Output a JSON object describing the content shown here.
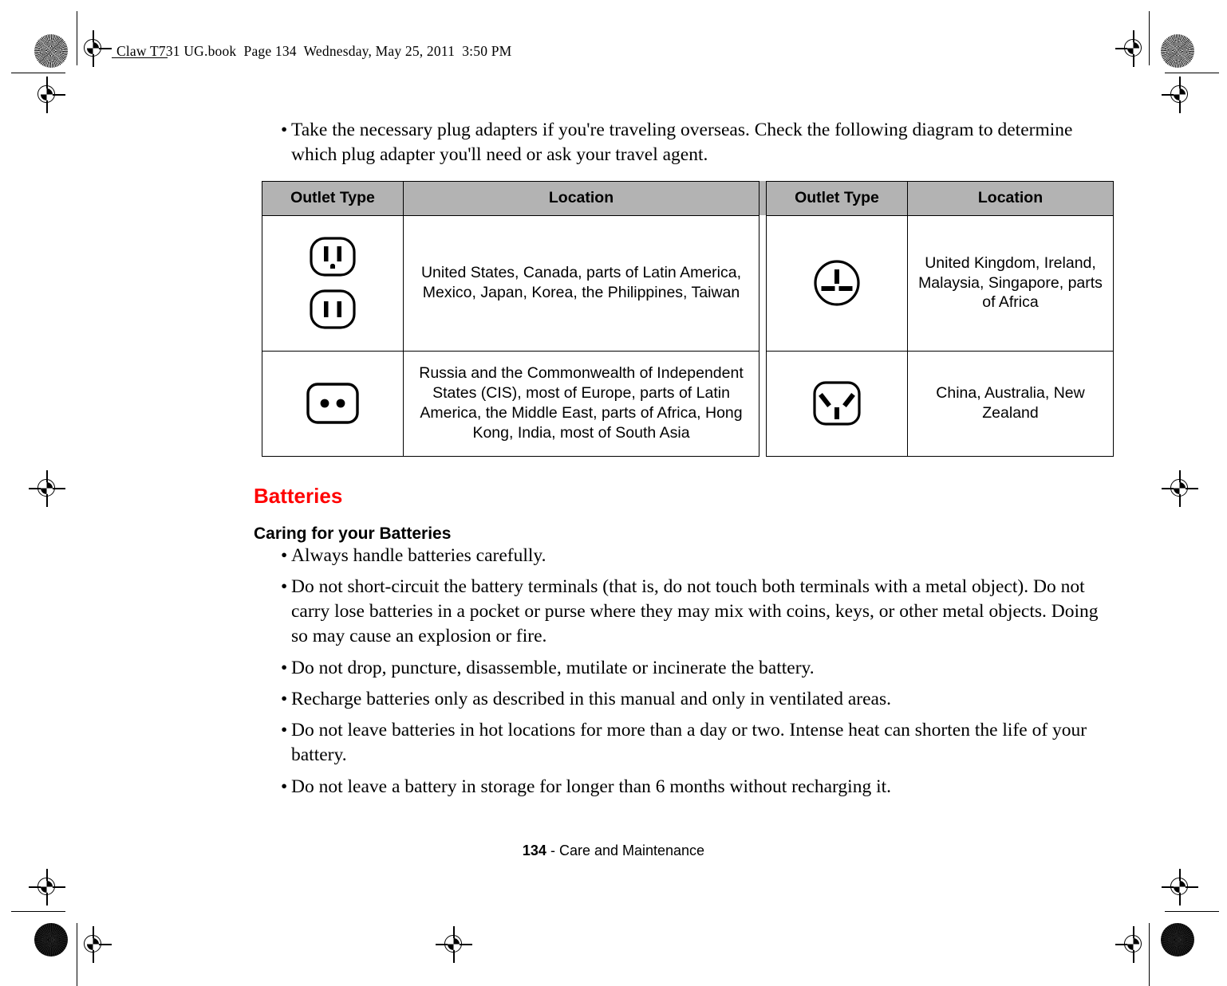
{
  "book_header": "Claw T731 UG.book  Page 134  Wednesday, May 25, 2011  3:50 PM",
  "intro_bullet": "Take the necessary plug adapters if you're traveling overseas. Check the following diagram to determine which plug adapter you'll need or ask your travel agent.",
  "bullet_glyph": "•",
  "outlet_table": {
    "headers": {
      "outlet_type_left": "Outlet Type",
      "location_left": "Location",
      "outlet_type_right": "Outlet Type",
      "location_right": "Location"
    },
    "rows": [
      {
        "left_icons": [
          "us-grounded-outlet-icon",
          "us-ungrounded-outlet-icon"
        ],
        "left_location": "United States, Canada, parts of Latin America, Mexico, Japan, Korea, the Philippines, Taiwan",
        "right_icons": [
          "uk-outlet-icon"
        ],
        "right_location": "United Kingdom, Ireland, Malaysia, Singapore, parts of Africa"
      },
      {
        "left_icons": [
          "europlug-outlet-icon"
        ],
        "left_location": "Russia and the Commonwealth of Independent States (CIS), most of Europe, parts of Latin America, the Middle East, parts of Africa, Hong Kong, India, most of South Asia",
        "right_icons": [
          "australia-outlet-icon"
        ],
        "right_location": "China, Australia, New Zealand"
      }
    ],
    "header_background": "#b3b3b3"
  },
  "batteries_section": {
    "title": "Batteries",
    "title_color": "#ff0000",
    "subtitle": "Caring for your Batteries",
    "bullets": [
      "Always handle batteries carefully.",
      "Do not short-circuit the battery terminals (that is, do not touch both terminals with a metal object). Do not carry lose batteries in a pocket or purse where they may mix with coins, keys, or other metal objects. Doing so may cause an explosion or fire.",
      "Do not drop, puncture, disassemble, mutilate or incinerate the battery.",
      "Recharge batteries only as described in this manual and only in ventilated areas.",
      "Do not leave batteries in hot locations for more than a day or two. Intense heat can shorten the life of your battery.",
      "Do not leave a battery in storage for longer than 6 months without recharging it."
    ]
  },
  "footer": {
    "page_number": "134",
    "separator_and_title": " - Care and Maintenance"
  }
}
